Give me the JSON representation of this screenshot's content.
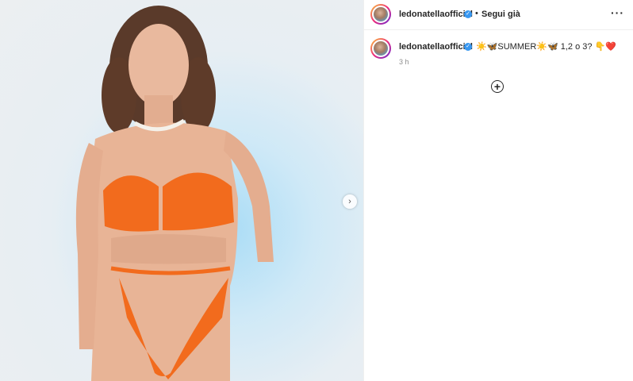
{
  "post": {
    "username": "ledonatella​official",
    "verified": true,
    "separator": "•",
    "follow_label": "Segui già",
    "more_label": "···",
    "caption": "☀️🦋SUMMER☀️🦋 1,2 o 3? 👇❤️",
    "timestamp": "3 h",
    "add_comment_label": "+"
  },
  "media": {
    "next_label": "›",
    "description": "photo"
  },
  "colors": {
    "verified": "#3897f0",
    "text": "#262626",
    "muted": "#8e8e8e",
    "swimsuit": "#f26b1d"
  },
  "icons": [
    "verified-icon",
    "more-icon",
    "add-comment-icon",
    "next-arrow-icon"
  ]
}
